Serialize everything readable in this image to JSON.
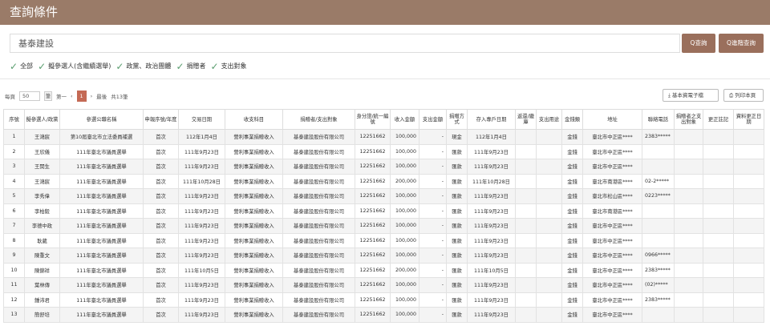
{
  "header": {
    "title": "查詢條件"
  },
  "search": {
    "value": "基泰建設",
    "search_label": "Q查詢",
    "advanced_label": "Q進階查詢"
  },
  "filters": [
    "全部",
    "擬參選人(含繼續選舉)",
    "政黨、政治團體",
    "捐贈者",
    "支出對象"
  ],
  "pager": {
    "prefix": "每頁",
    "page_size": "50",
    "suffix": "筆",
    "first": "第一",
    "prev": "‹",
    "current": "1",
    "next": "›",
    "last": "最後",
    "total": "共13筆"
  },
  "actions": {
    "download_label": "基本資電子檔",
    "print_label": "列印本頁"
  },
  "table": {
    "headers": [
      "序號",
      "擬參選人/政黨",
      "參選公職名稱",
      "申報序號/年度",
      "交易日期",
      "收支科目",
      "捐贈者/支出對象",
      "身分證/統一編號",
      "收入金額",
      "支出金額",
      "捐贈方式",
      "存入專戶日期",
      "返還/繳庫",
      "支出用途",
      "金錢類",
      "地址",
      "聯絡電話",
      "捐贈者之支出對象",
      "更正註記",
      "資料更正日期"
    ],
    "rows": [
      [
        "1",
        "王鴻宸",
        "第10屆臺北市立法委員補選",
        "首次",
        "112年1月4日",
        "營利事業捐贈收入",
        "基泰建設股份有限公司",
        "12251662",
        "100,000",
        "-",
        "現金",
        "112年1月4日",
        "",
        "",
        "金錢",
        "臺北市中正區****",
        "2383*****",
        "",
        "",
        ""
      ],
      [
        "2",
        "王欣儀",
        "111年臺北市議員選舉",
        "首次",
        "111年9月23日",
        "營利事業捐贈收入",
        "基泰建設股份有限公司",
        "12251662",
        "100,000",
        "-",
        "匯款",
        "111年9月23日",
        "",
        "",
        "金錢",
        "臺北市中正區****",
        "",
        "",
        "",
        ""
      ],
      [
        "3",
        "王閔生",
        "111年臺北市議員選舉",
        "首次",
        "111年9月23日",
        "營利事業捐贈收入",
        "基泰建設股份有限公司",
        "12251662",
        "100,000",
        "-",
        "匯款",
        "111年9月23日",
        "",
        "",
        "金錢",
        "臺北市中正區****",
        "",
        "",
        "",
        ""
      ],
      [
        "4",
        "王鴻宸",
        "111年臺北市議員選舉",
        "首次",
        "111年10月28日",
        "營利事業捐贈收入",
        "基泰建設股份有限公司",
        "12251662",
        "200,000",
        "-",
        "匯款",
        "111年10月28日",
        "",
        "",
        "金錢",
        "臺北市南港區****",
        "02-2*****",
        "",
        "",
        ""
      ],
      [
        "5",
        "李秀偉",
        "111年臺北市議員選舉",
        "首次",
        "111年9月23日",
        "營利事業捐贈收入",
        "基泰建設股份有限公司",
        "12251662",
        "100,000",
        "-",
        "匯款",
        "111年9月23日",
        "",
        "",
        "金錢",
        "臺北市松山區****",
        "0223*****",
        "",
        "",
        ""
      ],
      [
        "6",
        "李柏毅",
        "111年臺北市議員選舉",
        "首次",
        "111年9月23日",
        "營利事業捐贈收入",
        "基泰建設股份有限公司",
        "12251662",
        "100,000",
        "-",
        "匯款",
        "111年9月23日",
        "",
        "",
        "金錢",
        "臺北市南港區****",
        "",
        "",
        "",
        ""
      ],
      [
        "7",
        "李德中政",
        "111年臺北市議員選舉",
        "首次",
        "111年9月23日",
        "營利事業捐贈收入",
        "基泰建設股份有限公司",
        "12251662",
        "100,000",
        "-",
        "匯款",
        "111年9月23日",
        "",
        "",
        "金錢",
        "臺北市中正區****",
        "",
        "",
        "",
        ""
      ],
      [
        "8",
        "耿葳",
        "111年臺北市議員選舉",
        "首次",
        "111年9月23日",
        "營利事業捐贈收入",
        "基泰建設股份有限公司",
        "12251662",
        "100,000",
        "-",
        "匯款",
        "111年9月23日",
        "",
        "",
        "金錢",
        "臺北市中正區****",
        "",
        "",
        "",
        ""
      ],
      [
        "9",
        "陳重文",
        "111年臺北市議員選舉",
        "首次",
        "111年9月23日",
        "營利事業捐贈收入",
        "基泰建設股份有限公司",
        "12251662",
        "100,000",
        "-",
        "匯款",
        "111年9月23日",
        "",
        "",
        "金錢",
        "臺北市中正區****",
        "0966*****",
        "",
        "",
        ""
      ],
      [
        "10",
        "陳錦祥",
        "111年臺北市議員選舉",
        "首次",
        "111年10月5日",
        "營利事業捐贈收入",
        "基泰建設股份有限公司",
        "12251662",
        "200,000",
        "-",
        "匯款",
        "111年10月5日",
        "",
        "",
        "金錢",
        "臺北市中正區****",
        "2383*****",
        "",
        "",
        ""
      ],
      [
        "11",
        "葉林傳",
        "111年臺北市議員選舉",
        "首次",
        "111年9月23日",
        "營利事業捐贈收入",
        "基泰建設股份有限公司",
        "12251662",
        "100,000",
        "-",
        "匯款",
        "111年9月23日",
        "",
        "",
        "金錢",
        "臺北市中正區****",
        "(02)*****",
        "",
        "",
        ""
      ],
      [
        "12",
        "鍾沛君",
        "111年臺北市議員選舉",
        "首次",
        "111年9月23日",
        "營利事業捐贈收入",
        "基泰建設股份有限公司",
        "12251662",
        "100,000",
        "-",
        "匯款",
        "111年9月23日",
        "",
        "",
        "金錢",
        "臺北市中正區****",
        "2383*****",
        "",
        "",
        ""
      ],
      [
        "13",
        "簡舒培",
        "111年臺北市議員選舉",
        "首次",
        "111年9月23日",
        "營利事業捐贈收入",
        "基泰建設股份有限公司",
        "12251662",
        "100,000",
        "-",
        "匯款",
        "111年9月23日",
        "",
        "",
        "金錢",
        "臺北市中正區****",
        "",
        "",
        "",
        ""
      ]
    ]
  }
}
